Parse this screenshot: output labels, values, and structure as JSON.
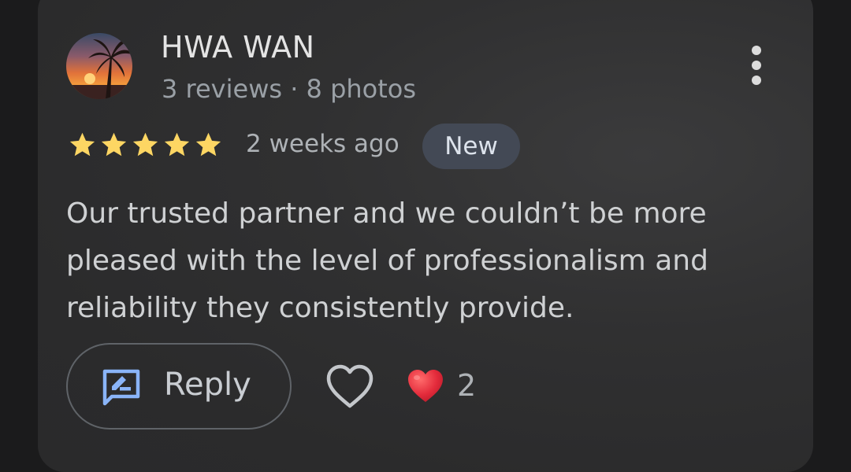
{
  "review": {
    "author_name": "HWA WAN",
    "author_meta": "3 reviews · 8 photos",
    "rating": 5,
    "rating_max": 5,
    "time_ago": "2 weeks ago",
    "badge": "New",
    "text": "Our trusted partner and we couldn’t be more pleased with the level of professionalism and reliability they consistently provide.",
    "reply_label": "Reply",
    "reaction_count": "2"
  },
  "colors": {
    "star": "#fdd663",
    "reply_icon": "#8ab4f8",
    "heart_emoji": "#e32b3b",
    "badge_bg": "#434955"
  },
  "icons": {
    "avatar": "sunset-palm-photo",
    "menu": "more-vert-icon",
    "reply": "rate-review-icon",
    "like": "heart-outline-icon",
    "reaction": "red-heart-emoji"
  }
}
